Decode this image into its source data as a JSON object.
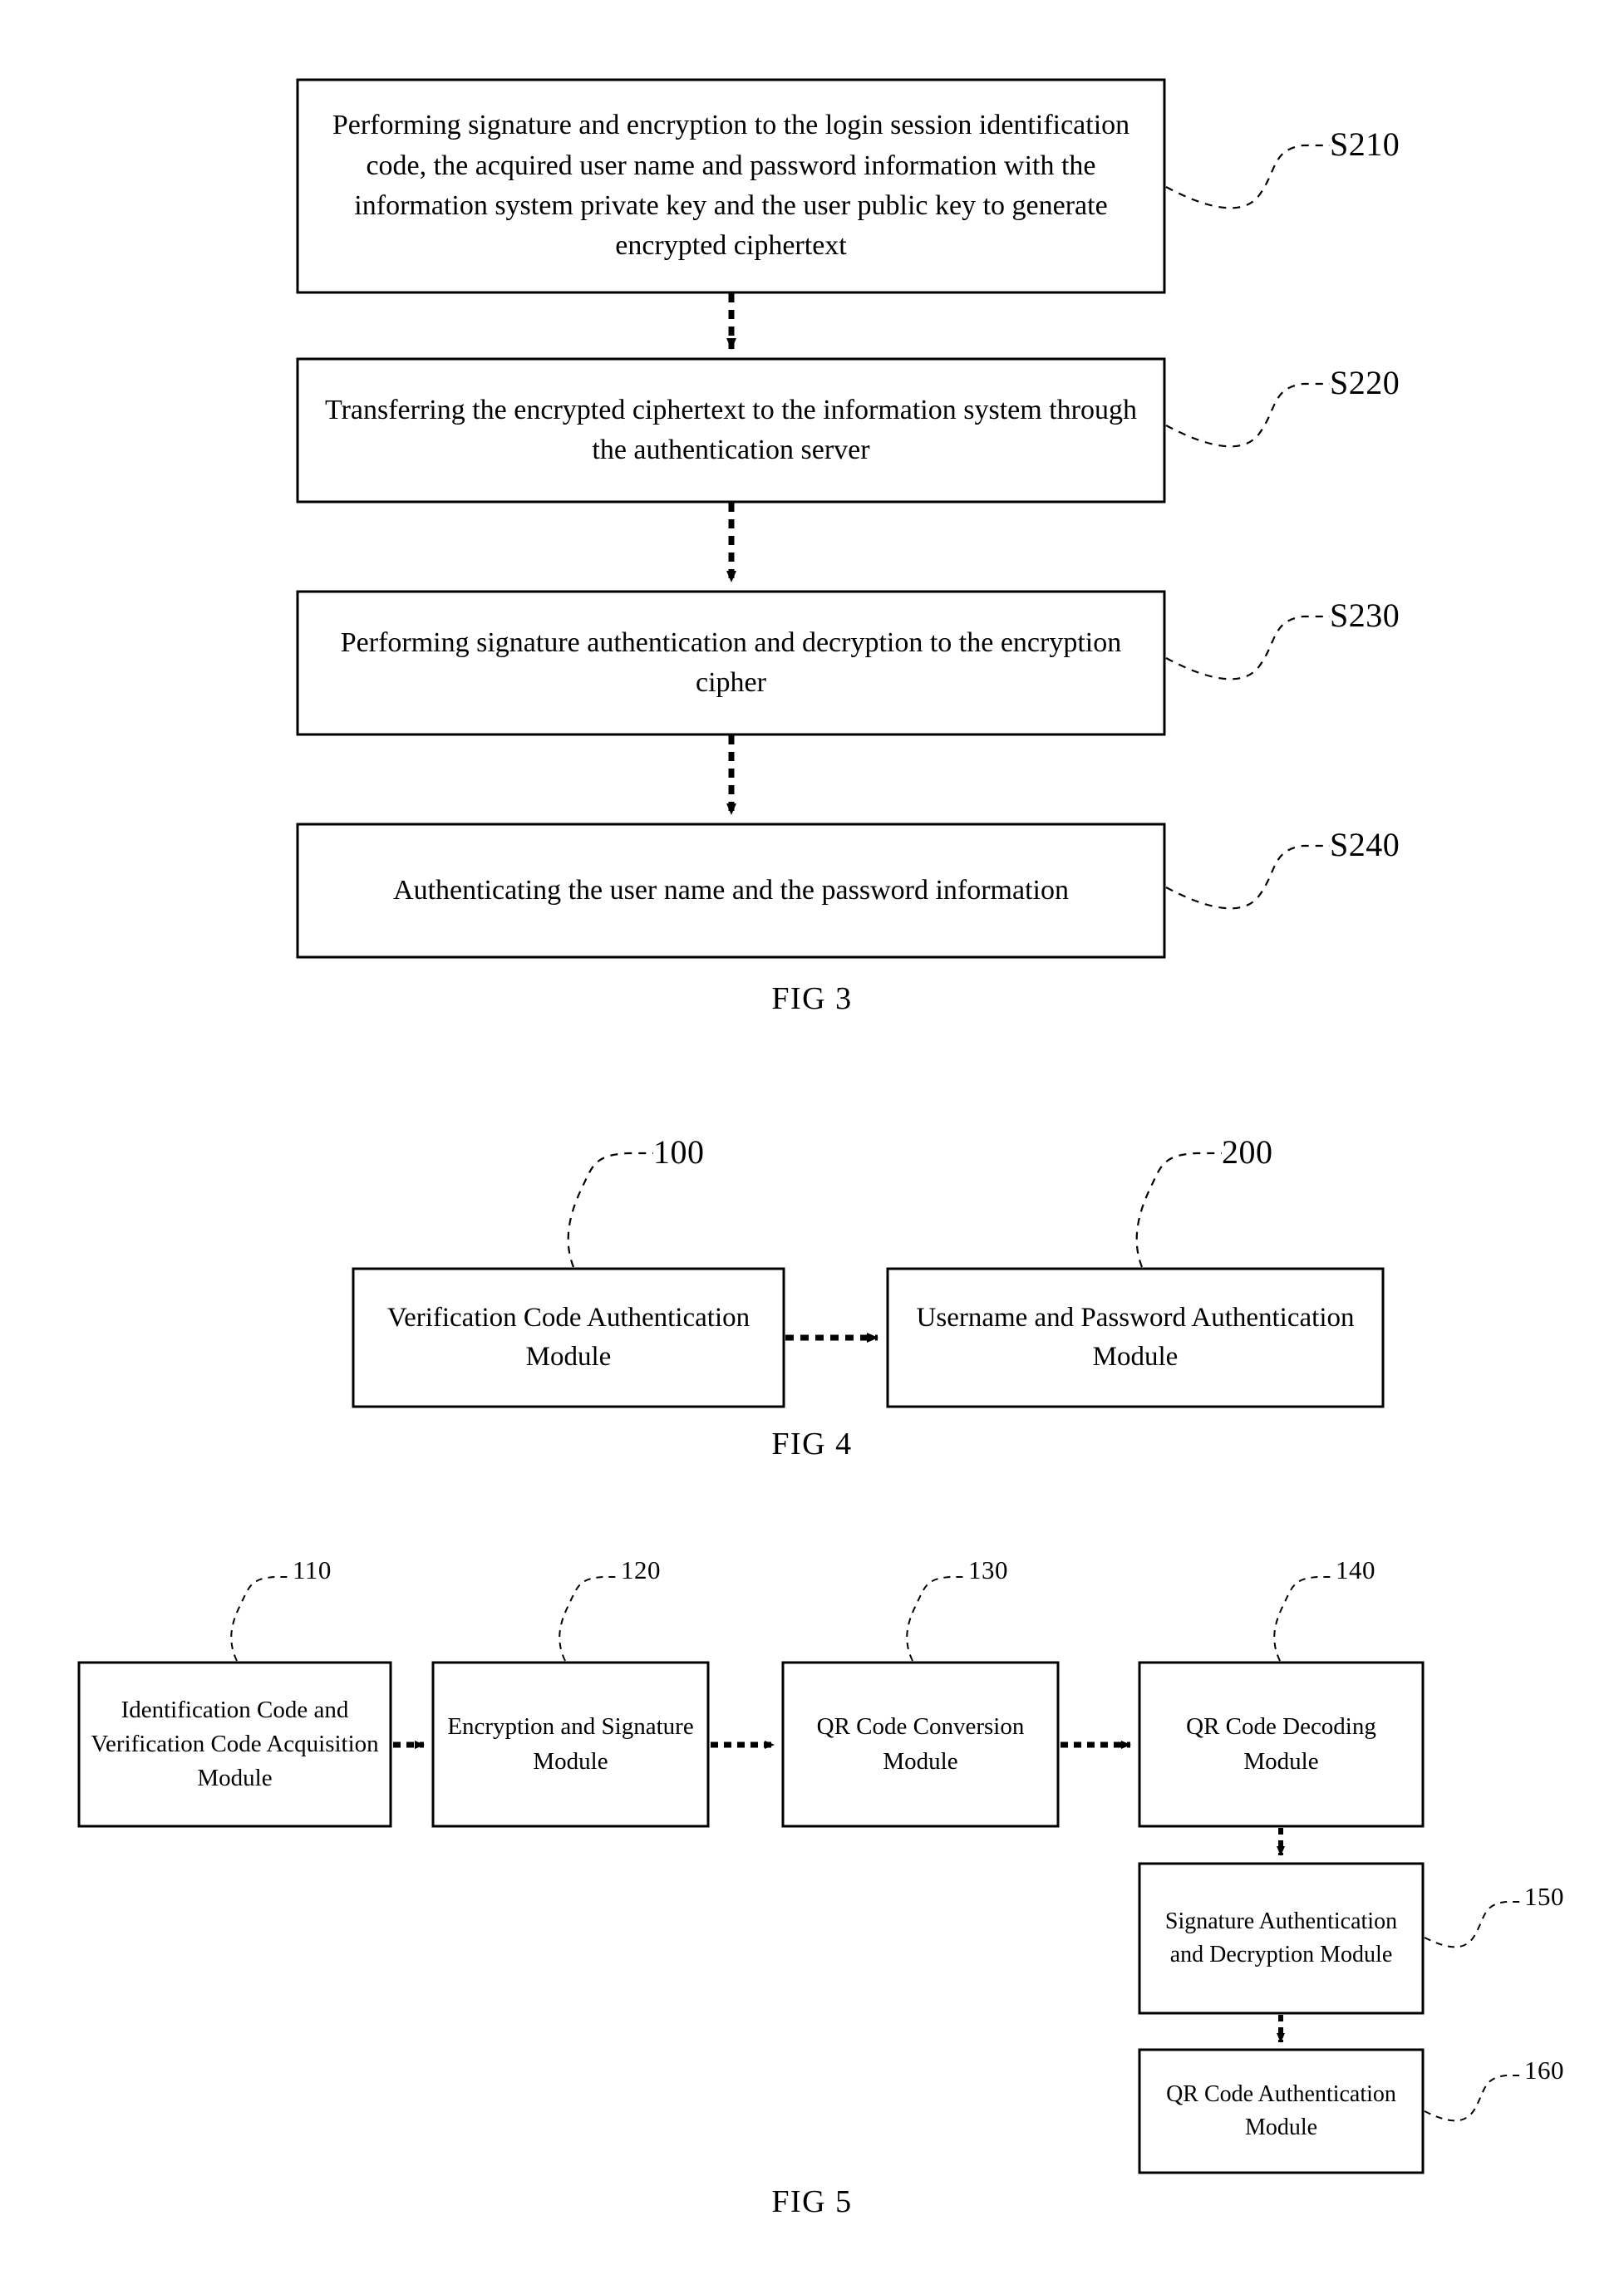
{
  "document": {
    "type": "patent-drawing-sheet",
    "background_color": "#ffffff",
    "line_color": "#000000"
  },
  "figures": [
    {
      "id": "fig3",
      "caption": "FIG 3",
      "kind": "flowchart",
      "steps": [
        {
          "ref": "S210",
          "text": "Performing signature and encryption to the login session identification code, the acquired user name and password information with the information system private key and the user public key to generate encrypted ciphertext"
        },
        {
          "ref": "S220",
          "text": "Transferring the encrypted ciphertext to the information system through the authentication server"
        },
        {
          "ref": "S230",
          "text": "Performing signature authentication and decryption to the encryption cipher"
        },
        {
          "ref": "S240",
          "text": "Authenticating the user name and the password information"
        }
      ]
    },
    {
      "id": "fig4",
      "caption": "FIG 4",
      "kind": "block-diagram",
      "blocks": [
        {
          "ref": "100",
          "text": "Verification Code Authentication Module"
        },
        {
          "ref": "200",
          "text": "Username and Password Authentication Module"
        }
      ]
    },
    {
      "id": "fig5",
      "caption": "FIG 5",
      "kind": "block-diagram",
      "blocks": [
        {
          "ref": "110",
          "text": "Identification Code and Verification Code Acquisition Module"
        },
        {
          "ref": "120",
          "text": "Encryption and Signature Module"
        },
        {
          "ref": "130",
          "text": "QR Code Conversion Module"
        },
        {
          "ref": "140",
          "text": "QR Code Decoding Module"
        },
        {
          "ref": "150",
          "text": "Signature Authentication and Decryption Module"
        },
        {
          "ref": "160",
          "text": "QR Code Authentication Module"
        }
      ]
    }
  ]
}
